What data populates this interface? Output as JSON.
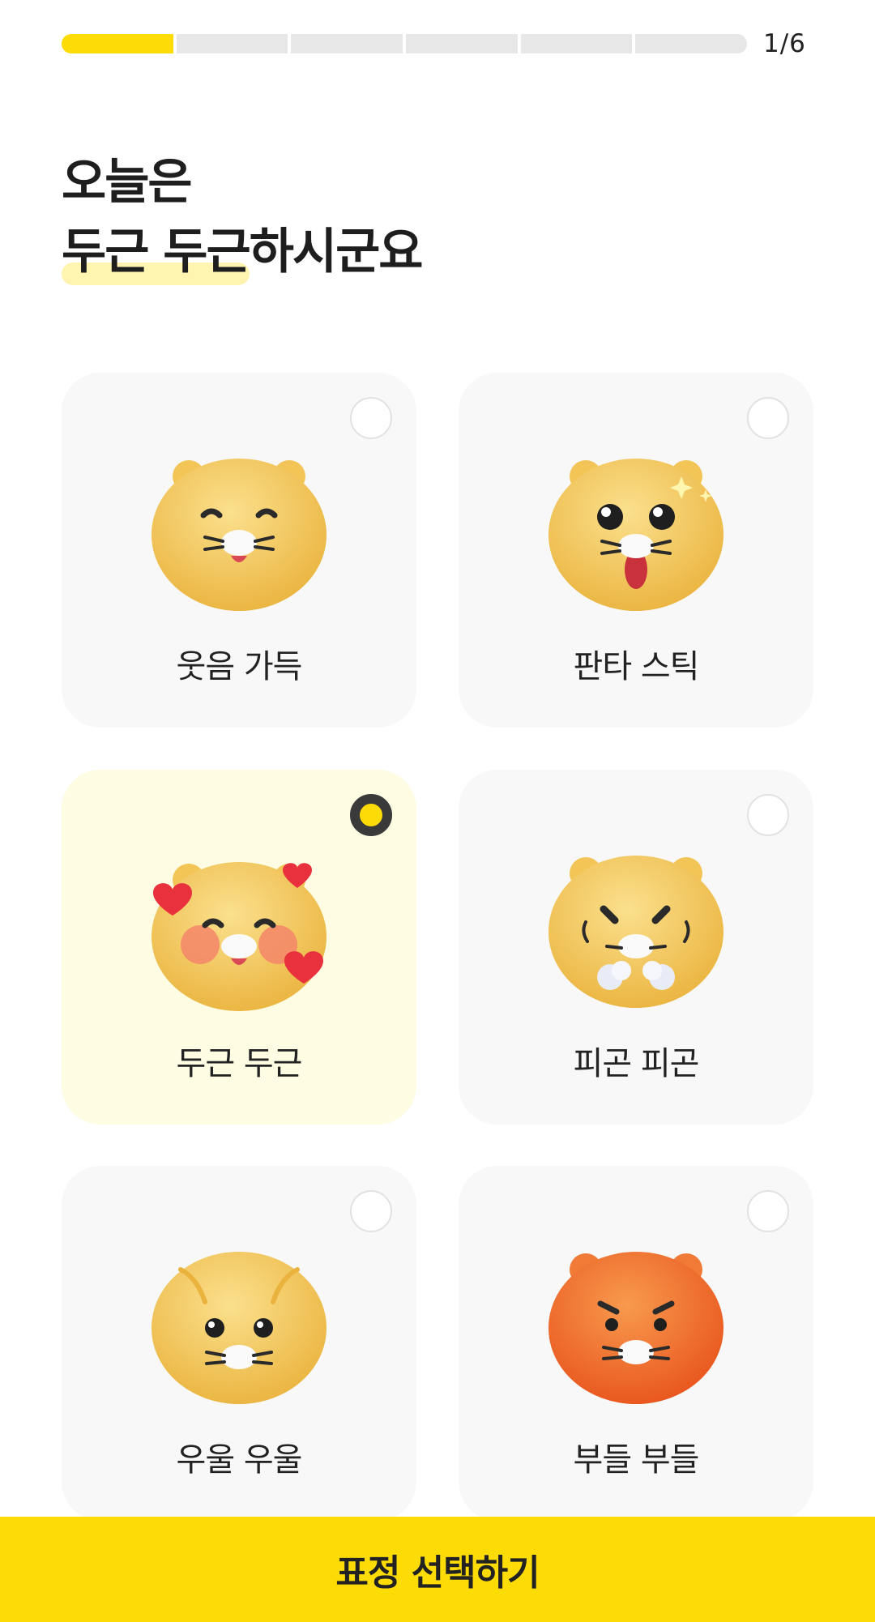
{
  "progress": {
    "current": 1,
    "total": 6,
    "label": "1/6"
  },
  "title": {
    "line1": "오늘은",
    "highlight": "두근 두근",
    "rest": "하시군요"
  },
  "emotions": [
    {
      "label": "웃음 가득",
      "selected": false,
      "icon": "smiling-face-icon"
    },
    {
      "label": "판타 스틱",
      "selected": false,
      "icon": "amazed-face-icon"
    },
    {
      "label": "두근 두근",
      "selected": true,
      "icon": "heart-face-icon"
    },
    {
      "label": "피곤 피곤",
      "selected": false,
      "icon": "tired-face-icon"
    },
    {
      "label": "우울 우울",
      "selected": false,
      "icon": "sad-face-icon"
    },
    {
      "label": "부들 부들",
      "selected": false,
      "icon": "angry-face-icon"
    }
  ],
  "cta": {
    "label": "표정 선택하기"
  },
  "colors": {
    "accent": "#FDDC05",
    "selected_card": "#FEFCE3",
    "card": "#F8F8F8",
    "face": "#F5C55A",
    "angry_face": "#F06A28"
  }
}
